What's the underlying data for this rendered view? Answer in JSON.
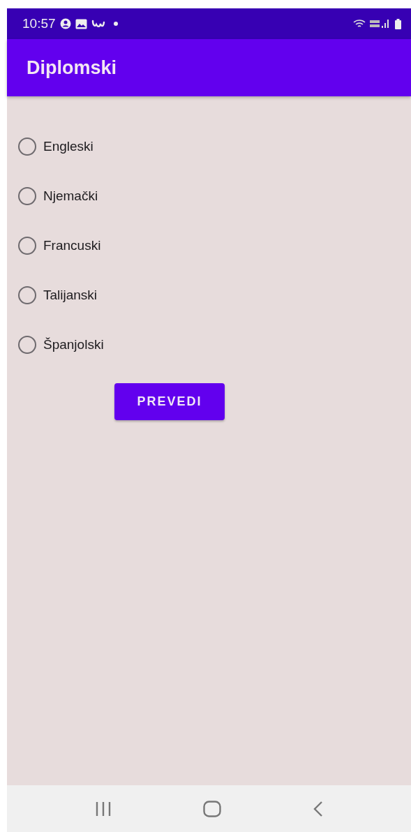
{
  "status_bar": {
    "time": "10:57"
  },
  "app_bar": {
    "title": "Diplomski"
  },
  "languages": [
    {
      "label": "Engleski",
      "selected": false
    },
    {
      "label": "Njemački",
      "selected": false
    },
    {
      "label": "Francuski",
      "selected": false
    },
    {
      "label": "Talijanski",
      "selected": false
    },
    {
      "label": "Španjolski",
      "selected": false
    }
  ],
  "button": {
    "label": "PREVEDI"
  },
  "nav_bar": [
    {
      "kind": "recents"
    },
    {
      "kind": "home"
    },
    {
      "kind": "back"
    }
  ]
}
